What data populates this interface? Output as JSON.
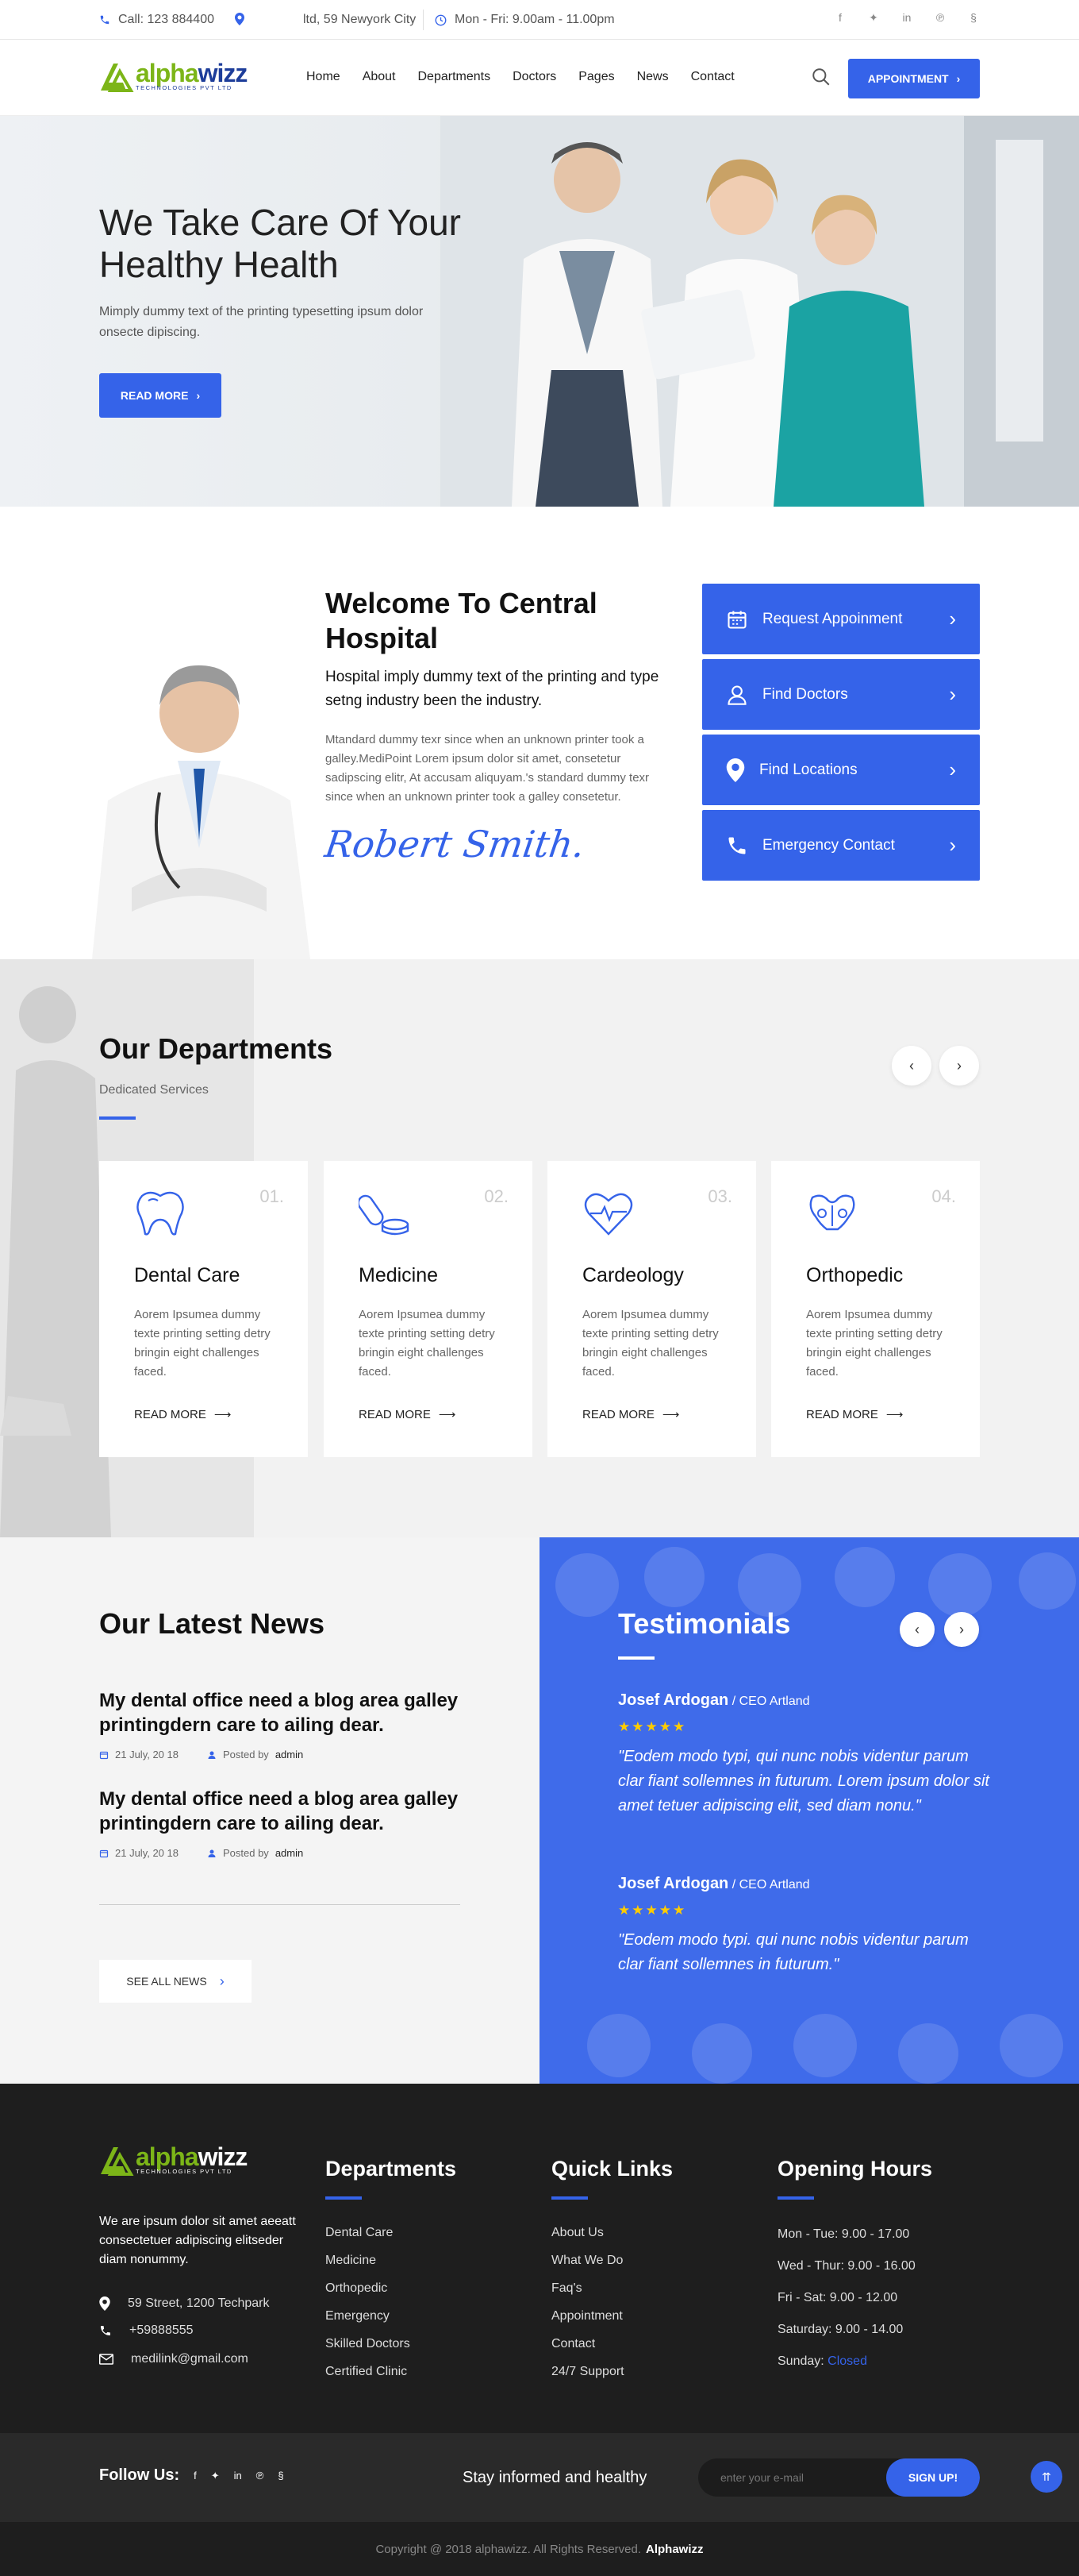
{
  "topbar": {
    "phone": "Call: 123 884400",
    "address": "ltd, 59 Newyork City",
    "hours": "Mon - Fri: 9.00am - 11.00pm",
    "social_icons": [
      "facebook-icon",
      "twitter-icon",
      "linkedin-icon",
      "pinterest-icon",
      "skype-icon"
    ]
  },
  "header": {
    "logo_main_a": "alpha",
    "logo_main_b": "wizz",
    "logo_sub": "TECHNOLOGIES PVT LTD",
    "nav": [
      "Home",
      "About",
      "Departments",
      "Doctors",
      "Pages",
      "News",
      "Contact"
    ],
    "appointment_label": "APPOINTMENT"
  },
  "hero": {
    "title": "We Take Care Of Your Healthy Health",
    "text": "Mimply dummy text of the printing typesetting ipsum dolor onsecte dipiscing.",
    "button": "READ MORE"
  },
  "welcome": {
    "title": "Welcome To Central Hospital",
    "lead": "Hospital imply dummy text of the printing and type setng industry been the industry.",
    "text": "Mtandard dummy texr since when an unknown printer took a galley.MediPoint Lorem ipsum dolor sit amet, consetetur sadipscing elitr, At accusam aliquyam.'s standard dummy texr since when an unknown printer took a galley consetetur.",
    "signature": "Robert Smith.",
    "quick_links": [
      {
        "label": "Request Appoinment",
        "icon": "calendar-icon"
      },
      {
        "label": "Find Doctors",
        "icon": "user-icon"
      },
      {
        "label": "Find Locations",
        "icon": "location-pin-icon"
      },
      {
        "label": "Emergency Contact",
        "icon": "phone-icon"
      }
    ]
  },
  "departments": {
    "title": "Our Departments",
    "subtitle": "Dedicated Services",
    "cards": [
      {
        "num": "01.",
        "title": "Dental Care",
        "text": "Aorem Ipsumea dummy texte printing setting detry bringin eight challenges faced.",
        "more": "READ MORE",
        "icon": "tooth-icon"
      },
      {
        "num": "02.",
        "title": "Medicine",
        "text": "Aorem Ipsumea dummy texte printing setting detry bringin eight challenges faced.",
        "more": "READ MORE",
        "icon": "pill-icon"
      },
      {
        "num": "03.",
        "title": "Cardeology",
        "text": "Aorem Ipsumea dummy texte printing setting detry bringin eight challenges faced.",
        "more": "READ MORE",
        "icon": "heart-pulse-icon"
      },
      {
        "num": "04.",
        "title": "Orthopedic",
        "text": "Aorem Ipsumea dummy texte printing setting detry bringin eight challenges faced.",
        "more": "READ MORE",
        "icon": "pelvis-bone-icon"
      }
    ]
  },
  "news": {
    "title": "Our Latest News",
    "items": [
      {
        "headline": "My dental office need a blog area galley printingdern care to ailing dear.",
        "date": "21 July, 20 18",
        "posted_by": "Posted by",
        "author": "admin"
      },
      {
        "headline": "My dental office need a blog area galley printingdern care to ailing dear.",
        "date": "21 July, 20 18",
        "posted_by": "Posted by",
        "author": "admin"
      }
    ],
    "see_all": "SEE ALL NEWS"
  },
  "testimonials": {
    "title": "Testimonials",
    "items": [
      {
        "name": "Josef Ardogan",
        "role": "/ CEO Artland",
        "stars": "★★★★★",
        "quote": "\"Eodem modo typi, qui nunc nobis videntur parum clar fiant sollemnes in futurum. Lorem ipsum dolor sit amet tetuer adipiscing elit, sed diam nonu.\""
      },
      {
        "name": "Josef Ardogan",
        "role": "/ CEO Artland",
        "stars": "★★★★★",
        "quote": "\"Eodem modo typi. qui nunc nobis videntur parum clar fiant sollemnes in futurum.\""
      }
    ]
  },
  "footer": {
    "about": "We are ipsum dolor sit amet aeeatt consectetuer adipiscing elitseder diam nonummy.",
    "address": "59 Street, 1200 Techpark",
    "phone": "+59888555",
    "email": "medilink@gmail.com",
    "departments_title": "Departments",
    "departments": [
      "Dental Care",
      "Medicine",
      "Orthopedic",
      "Emergency",
      "Skilled Doctors",
      "Certified Clinic"
    ],
    "quick_title": "Quick Links",
    "quick": [
      "About Us",
      "What We Do",
      "Faq's",
      "Appointment",
      "Contact",
      "24/7 Support"
    ],
    "hours_title": "Opening Hours",
    "hours": [
      "Mon - Tue: 9.00 - 17.00",
      "Wed - Thur: 9.00 - 16.00",
      "Fri - Sat: 9.00 - 12.00",
      "Saturday: 9.00 - 14.00"
    ],
    "sunday_label": "Sunday:",
    "sunday_value": "Closed"
  },
  "subbar": {
    "follow": "Follow Us:",
    "informed": "Stay informed and healthy",
    "email_placeholder": "enter your e-mail",
    "signup": "SIGN UP!"
  },
  "copyright": {
    "text": "Copyright @ 2018 alphawizz. All Rights Reserved.",
    "brand": "Alphawizz"
  },
  "colors": {
    "accent": "#3563e9",
    "logo_green": "#7cb518",
    "logo_navy": "#1d3d9a",
    "footer_bg": "#1e1e1e",
    "star": "#ffcc00"
  }
}
